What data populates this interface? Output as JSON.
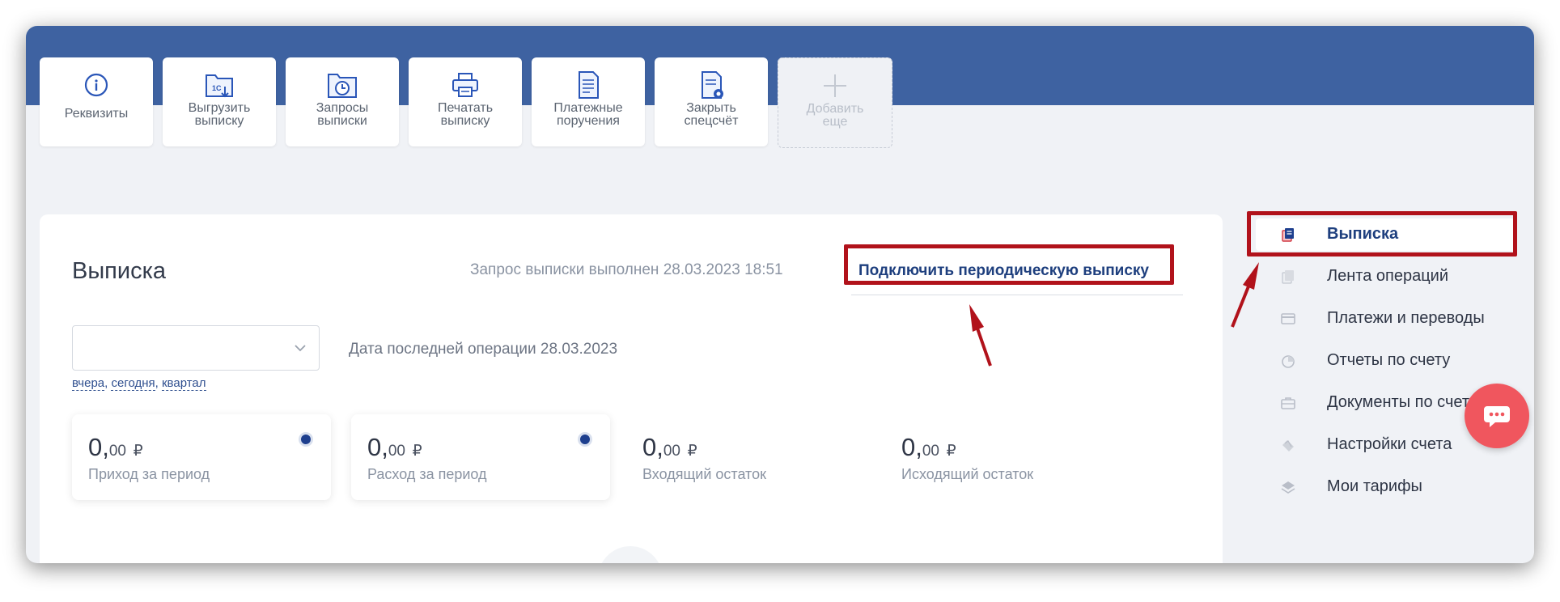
{
  "toolbar": {
    "tiles": [
      {
        "label": "Реквизиты",
        "icon": "info-icon"
      },
      {
        "label": "Выгрузить\nвыписку",
        "icon": "folder-1c-export-icon"
      },
      {
        "label": "Запросы\nвыписки",
        "icon": "folder-clock-icon"
      },
      {
        "label": "Печатать\nвыписку",
        "icon": "printer-icon"
      },
      {
        "label": "Платежные\nпоручения",
        "icon": "document-list-icon"
      },
      {
        "label": "Закрыть\nспецсчёт",
        "icon": "document-seal-icon"
      },
      {
        "label": "Добавить\nеще",
        "icon": "plus-icon"
      }
    ]
  },
  "statement": {
    "title": "Выписка",
    "request_status": "Запрос выписки выполнен 28.03.2023 18:51",
    "periodic_link": "Подключить периодическую выписку",
    "period_select_value": "",
    "quick_periods": [
      "вчера",
      "сегодня",
      "квартал"
    ],
    "last_operation": "Дата последней операции 28.03.2023",
    "stats": [
      {
        "int": "0,",
        "kop": "00",
        "currency": "₽",
        "label": "Приход за период",
        "selectable": true
      },
      {
        "int": "0,",
        "kop": "00",
        "currency": "₽",
        "label": "Расход за период",
        "selectable": true
      },
      {
        "int": "0,",
        "kop": "00",
        "currency": "₽",
        "label": "Входящий остаток",
        "selectable": false
      },
      {
        "int": "0,",
        "kop": "00",
        "currency": "₽",
        "label": "Исходящий остаток",
        "selectable": false
      }
    ]
  },
  "sidebar": {
    "items": [
      {
        "label": "Выписка",
        "icon": "statement-icon",
        "active": true
      },
      {
        "label": "Лента операций",
        "icon": "feed-icon",
        "active": false
      },
      {
        "label": "Платежи и переводы",
        "icon": "card-icon",
        "active": false
      },
      {
        "label": "Отчеты по счету",
        "icon": "pie-chart-icon",
        "active": false
      },
      {
        "label": "Документы по счету",
        "icon": "briefcase-icon",
        "active": false
      },
      {
        "label": "Настройки счета",
        "icon": "cards-icon",
        "active": false
      },
      {
        "label": "Мои тарифы",
        "icon": "layers-icon",
        "active": false
      }
    ]
  },
  "chat": {
    "icon": "chat-bubble-icon"
  },
  "colors": {
    "header": "#3e62a1",
    "accent": "#1e3f7e",
    "highlight": "#b1121b",
    "chat": "#f0565e"
  }
}
